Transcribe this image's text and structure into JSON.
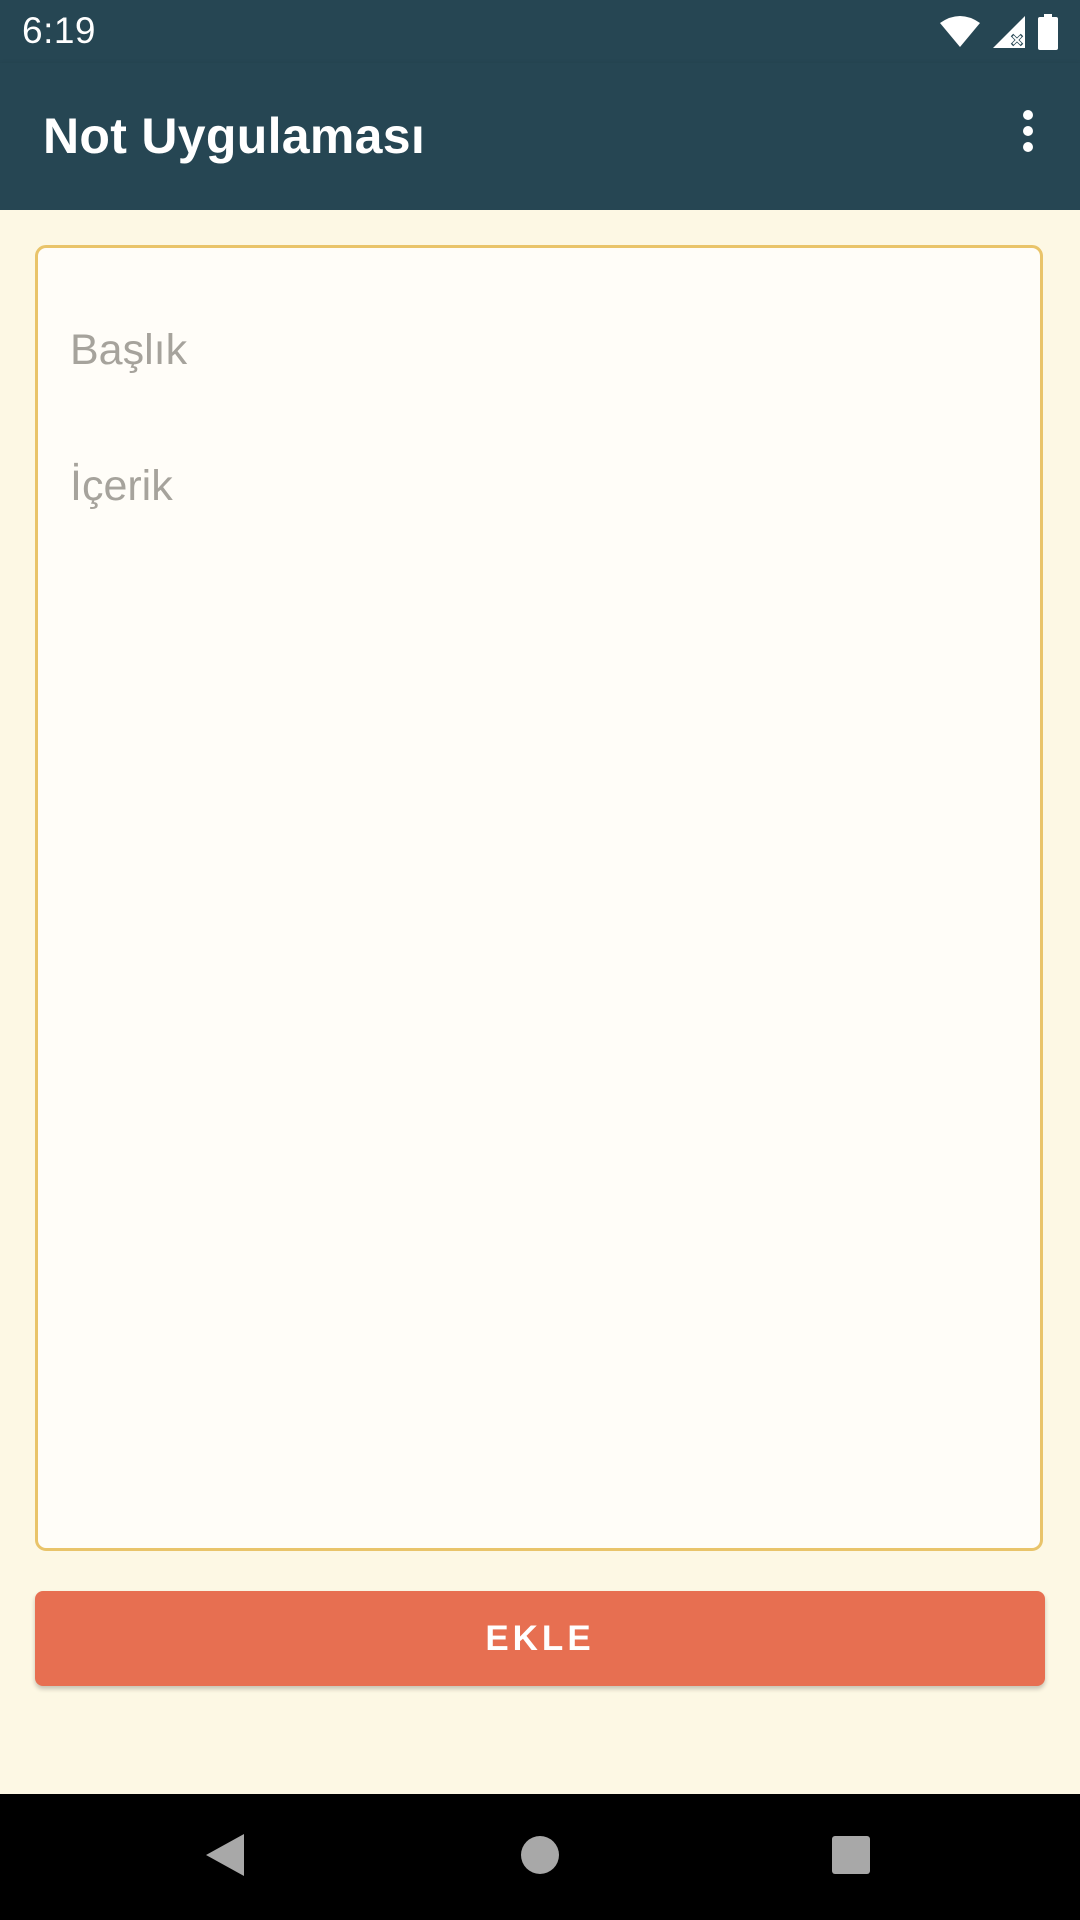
{
  "status_bar": {
    "time": "6:19",
    "icons": [
      "wifi-icon",
      "cellular-signal-icon",
      "battery-icon"
    ]
  },
  "app_bar": {
    "title": "Not Uygulaması",
    "overflow_icon": "more-vert-icon"
  },
  "form": {
    "title_placeholder": "Başlık",
    "content_placeholder": "İçerik",
    "add_button_label": "EKLE"
  },
  "nav_bar": {
    "icons": [
      "back-icon",
      "home-icon",
      "recents-icon"
    ]
  },
  "colors": {
    "primary": "#264653",
    "background": "#FDF8E4",
    "card_border": "#E9C46A",
    "accent": "#E76F51"
  }
}
